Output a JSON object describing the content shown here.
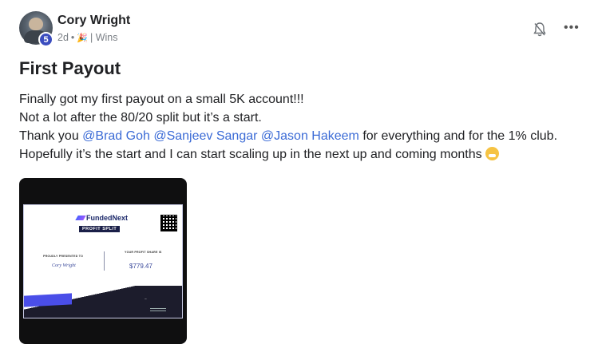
{
  "post": {
    "author": "Cory Wright",
    "level": "5",
    "time": "2d",
    "dot": "•",
    "category": "| Wins",
    "title": "First Payout",
    "line1": "Finally got my first payout on a small 5K account!!!",
    "line2": "Not a lot after the 80/20 split but it’s a start.",
    "line3_prefix": "Thank you ",
    "mention1": "@Brad Goh",
    "mention2": "@Sanjeev Sangar",
    "mention3": "@Jason Hakeem",
    "line3_suffix": " for everything and for the 1% club.",
    "line4": "Hopefully it’s the start and I can start scaling up in the next up and coming months",
    "more": "•••"
  },
  "certificate": {
    "brand": "FundedNext",
    "banner": "PROFIT SPLIT",
    "presented_label": "PROUDLY PRESENTED TO",
    "name": "Cory Wright",
    "share_label": "YOUR PROFIT SHARE IS",
    "amount": "$779.47"
  },
  "colors": {
    "mention": "#3b6bd6",
    "badge": "#3b4dbf",
    "accent_purple": "#4a4ee8"
  },
  "icons": [
    "bell-off-icon",
    "more-icon",
    "party-icon",
    "grinning-emoji-icon",
    "qr-code-icon"
  ]
}
